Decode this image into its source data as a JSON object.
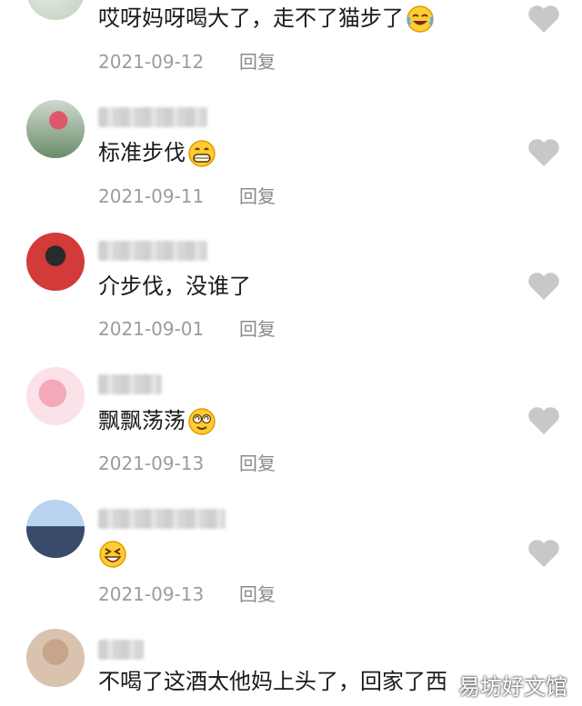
{
  "comments": [
    {
      "text": "哎呀妈呀喝大了，走不了猫步了",
      "emoji": "grin-tears-emoji-icon",
      "date": "2021-09-12",
      "reply": "回复"
    },
    {
      "text": "标准步伐",
      "emoji": "big-grin-emoji-icon",
      "date": "2021-09-11",
      "reply": "回复"
    },
    {
      "text": "介步伐，没谁了",
      "emoji": "",
      "date": "2021-09-01",
      "reply": "回复"
    },
    {
      "text": "飘飘荡荡",
      "emoji": "dizzy-face-emoji-icon",
      "date": "2021-09-13",
      "reply": "回复"
    },
    {
      "text": "",
      "emoji": "laughing-emoji-icon",
      "date": "2021-09-13",
      "reply": "回复"
    },
    {
      "text": "不喝了这酒太他妈上头了，回家了西",
      "emoji": "",
      "date": "",
      "reply": ""
    }
  ],
  "icons": {
    "like": "heart-icon",
    "like_color": "#c8c8c8"
  },
  "watermark": "易坊好文馆"
}
